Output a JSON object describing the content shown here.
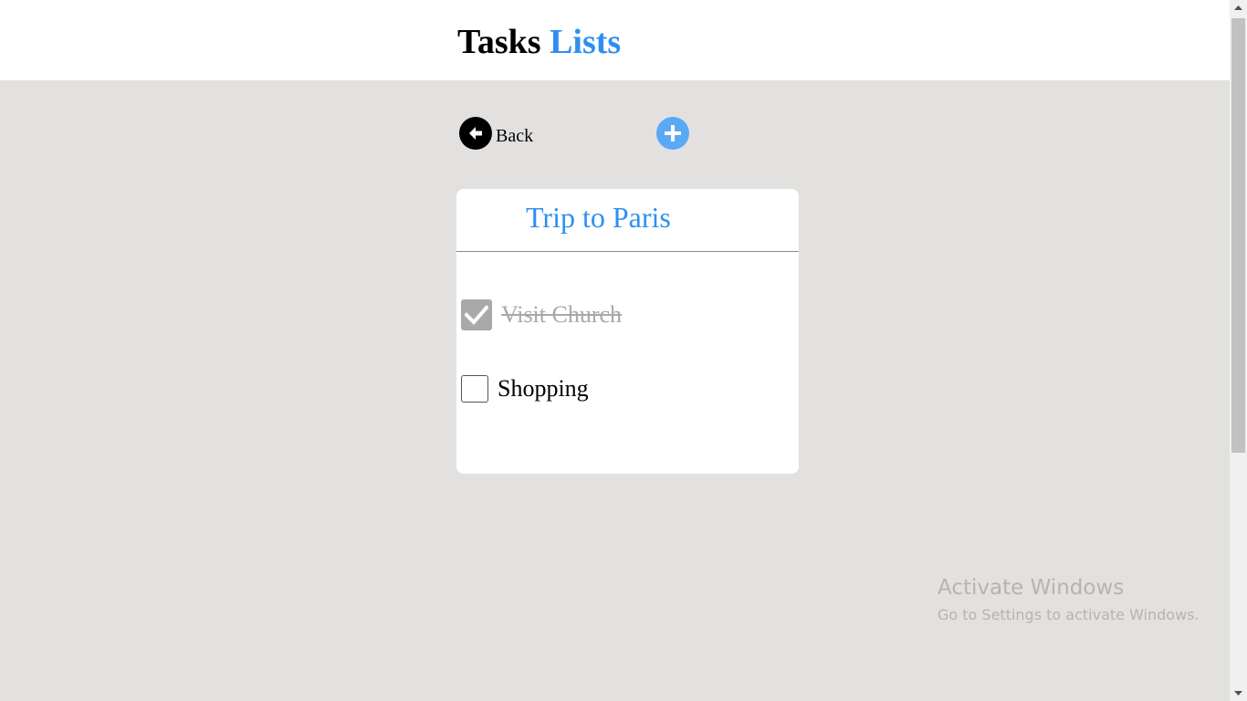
{
  "header": {
    "title_part1": "Tasks",
    "title_part2": "Lists"
  },
  "toolbar": {
    "back_label": "Back",
    "back_icon": "arrow-left-circle-icon",
    "add_icon": "plus-circle-icon"
  },
  "list": {
    "title": "Trip to Paris",
    "tasks": [
      {
        "label": "Visit Church",
        "checked": true
      },
      {
        "label": "Shopping",
        "checked": false
      }
    ]
  },
  "watermark": {
    "line1": "Activate Windows",
    "line2": "Go to Settings to activate Windows."
  },
  "colors": {
    "accent": "#2f8ff0",
    "add_button": "#5aa9f5",
    "background": "#e2e1e0",
    "done_text": "#a9a9a9"
  }
}
